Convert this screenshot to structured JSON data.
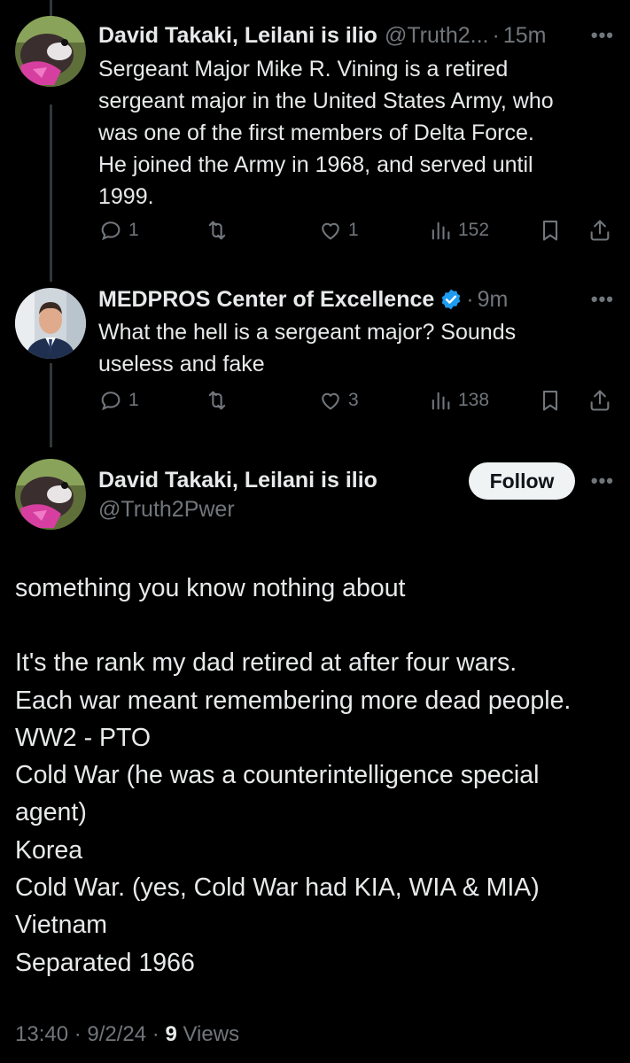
{
  "colors": {
    "background": "#000000",
    "text": "#e7e9ea",
    "secondary": "#71767b",
    "verified": "#1d9bf0",
    "follow_bg": "#eff3f4"
  },
  "tweets": [
    {
      "name": "David Takaki, Leilani is ilio",
      "handle": "@Truth2...",
      "time": "15m",
      "text": [
        "Sergeant Major Mike R. Vining is a retired",
        "sergeant major in the United States Army, who",
        "was one of the first members of Delta Force.",
        "He joined the Army in 1968, and served until",
        "1999."
      ],
      "replies": "1",
      "reposts": "",
      "likes": "1",
      "views": "152"
    },
    {
      "name": "MEDPROS Center of Excellence",
      "verified": true,
      "time": "9m",
      "text": [
        "What the hell is a sergeant major?  Sounds",
        "useless and fake"
      ],
      "replies": "1",
      "reposts": "",
      "likes": "3",
      "views": "138"
    }
  ],
  "main_tweet": {
    "name": "David Takaki, Leilani is ilio",
    "handle": "@Truth2Pwer",
    "follow_label": "Follow",
    "lines": [
      "something you know nothing about",
      "",
      "It's the rank my dad retired at after four wars.",
      "Each war meant remembering more dead people.",
      "WW2 - PTO",
      "Cold War (he was a counterintelligence special",
      "agent)",
      "Korea",
      "Cold War. (yes, Cold War had KIA, WIA & MIA)",
      "Vietnam",
      "Separated 1966"
    ],
    "timestamp": "13:40 · 9/2/24 ·",
    "views_count": "9",
    "views_label": "Views"
  },
  "icons": {
    "reply": "reply-icon",
    "repost": "repost-icon",
    "like": "heart-icon",
    "views": "views-icon",
    "bookmark": "bookmark-icon",
    "share": "share-icon",
    "more": "more-icon",
    "verified": "verified-badge-icon"
  }
}
